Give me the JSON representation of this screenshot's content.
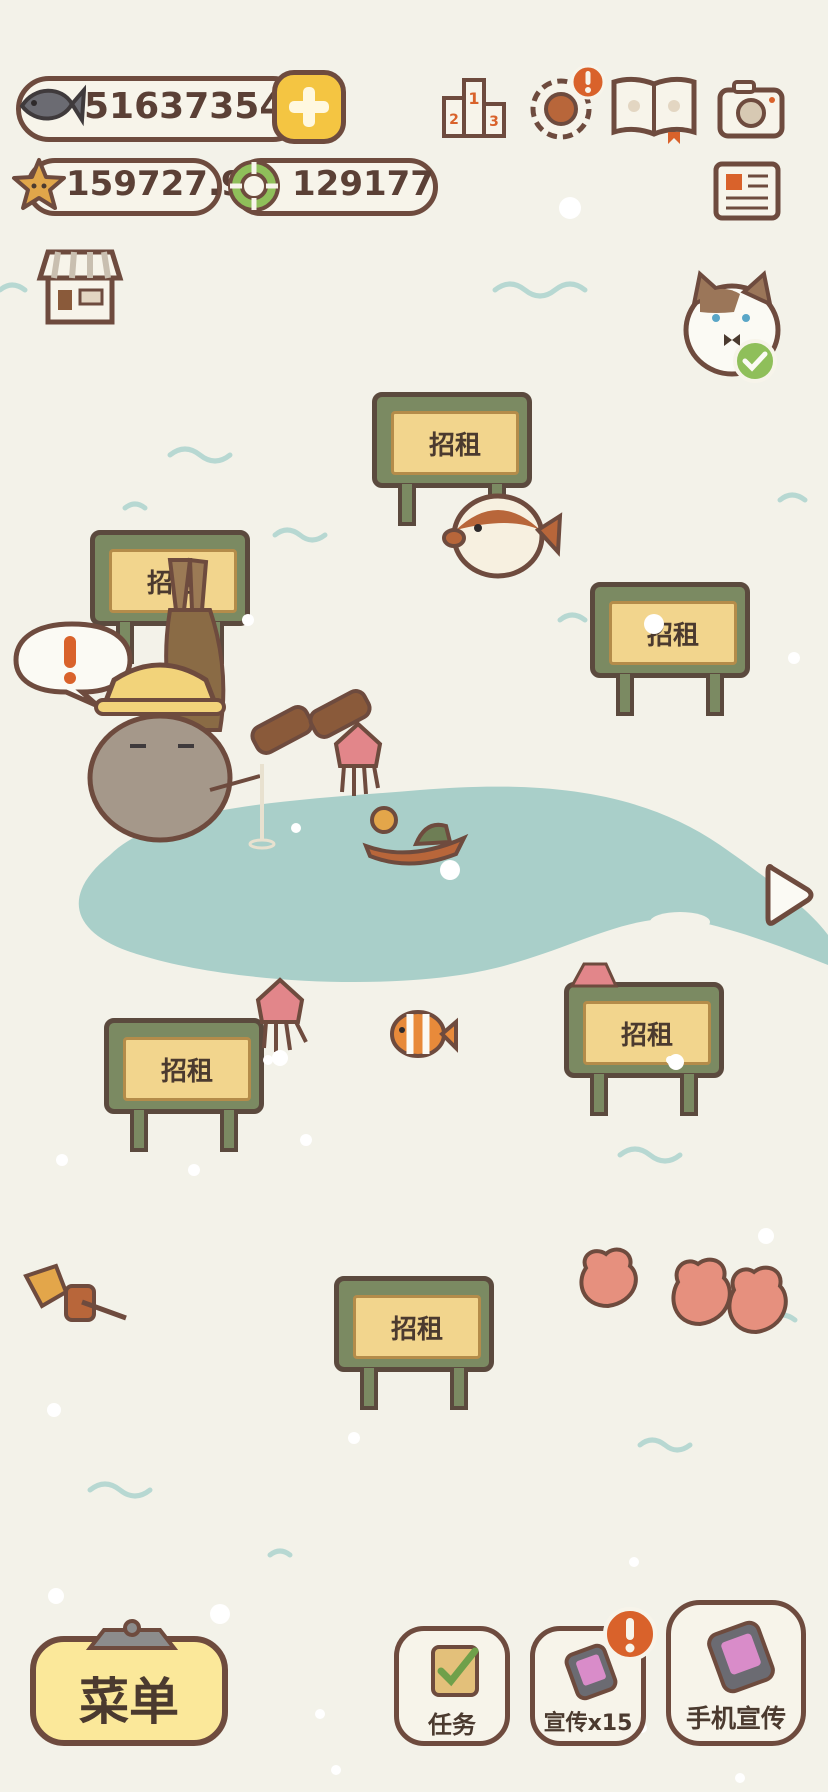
{
  "hud": {
    "fish_count": "516373543",
    "star_count": "159727.9",
    "ring_count": "129177"
  },
  "signs": [
    {
      "label": "招租"
    },
    {
      "label": "招租"
    },
    {
      "label": "招租"
    },
    {
      "label": "招租"
    },
    {
      "label": "招租"
    },
    {
      "label": "招租"
    }
  ],
  "bottom": {
    "menu_label": "菜单",
    "tasks_label": "任务",
    "promo_label": "宣传x15",
    "phone_promo_label": "手机宣传"
  },
  "icons": {
    "fish": "fish-icon",
    "add": "plus-icon",
    "star": "star-icon",
    "ring": "lifebuoy-icon",
    "ranking": "podium-icon",
    "settings": "gear-icon",
    "book": "paw-book-icon",
    "camera": "camera-icon",
    "news": "newspaper-icon",
    "shop": "shop-icon",
    "alert": "exclamation-icon",
    "next": "arrow-right-icon"
  },
  "colors": {
    "background": "#f3f2e9",
    "outline": "#6e4b3e",
    "water": "#a9cfc9",
    "sign_board": "#7b8a62",
    "sign_plank": "#f2d58d",
    "menu_button": "#fbe89a",
    "alert": "#d9622b"
  }
}
